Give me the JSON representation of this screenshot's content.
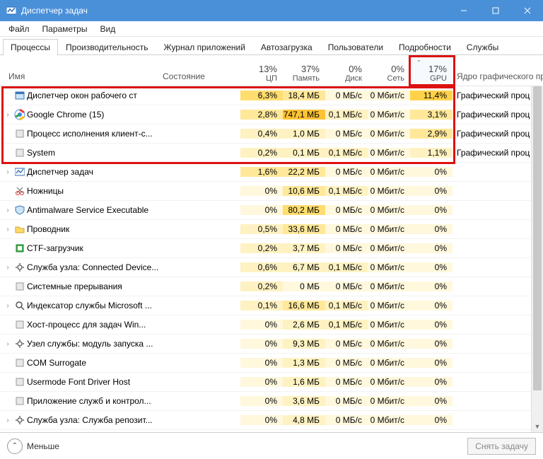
{
  "window": {
    "title": "Диспетчер задач"
  },
  "menu": {
    "file": "Файл",
    "options": "Параметры",
    "view": "Вид"
  },
  "tabs": {
    "processes": "Процессы",
    "performance": "Производительность",
    "apphistory": "Журнал приложений",
    "startup": "Автозагрузка",
    "users": "Пользователи",
    "details": "Подробности",
    "services": "Службы"
  },
  "columns": {
    "name": "Имя",
    "status": "Состояние",
    "cpu_pct": "13%",
    "cpu_lbl": "ЦП",
    "mem_pct": "37%",
    "mem_lbl": "Память",
    "disk_pct": "0%",
    "disk_lbl": "Диск",
    "net_pct": "0%",
    "net_lbl": "Сеть",
    "gpu_pct": "17%",
    "gpu_lbl": "GPU",
    "engine": "Ядро графического пр"
  },
  "rows": [
    {
      "exp": "",
      "icon": "window",
      "name": "Диспетчер окон рабочего ст",
      "cpu": "6,3%",
      "cpuH": 3,
      "mem": "18,4 МБ",
      "memH": 2,
      "disk": "0 МБ/с",
      "diskH": 0,
      "net": "0 Мбит/с",
      "netH": 0,
      "gpu": "11,4%",
      "gpuH": 4,
      "eng": "Графический проц"
    },
    {
      "exp": "›",
      "icon": "chrome",
      "name": "Google Chrome (15)",
      "cpu": "2,8%",
      "cpuH": 2,
      "mem": "747,1 МБ",
      "memH": 5,
      "disk": "0,1 МБ/с",
      "diskH": 1,
      "net": "0 Мбит/с",
      "netH": 0,
      "gpu": "3,1%",
      "gpuH": 2,
      "eng": "Графический проц"
    },
    {
      "exp": "",
      "icon": "app",
      "name": "Процесс исполнения клиент-с...",
      "cpu": "0,4%",
      "cpuH": 1,
      "mem": "1,0 МБ",
      "memH": 1,
      "disk": "0 МБ/с",
      "diskH": 0,
      "net": "0 Мбит/с",
      "netH": 0,
      "gpu": "2,9%",
      "gpuH": 2,
      "eng": "Графический проц"
    },
    {
      "exp": "",
      "icon": "app",
      "name": "System",
      "cpu": "0,2%",
      "cpuH": 1,
      "mem": "0,1 МБ",
      "memH": 1,
      "disk": "0,1 МБ/с",
      "diskH": 1,
      "net": "0 Мбит/с",
      "netH": 0,
      "gpu": "1,1%",
      "gpuH": 1,
      "eng": "Графический проц"
    },
    {
      "exp": "›",
      "icon": "taskmgr",
      "name": "Диспетчер задач",
      "cpu": "1,6%",
      "cpuH": 2,
      "mem": "22,2 МБ",
      "memH": 2,
      "disk": "0 МБ/с",
      "diskH": 0,
      "net": "0 Мбит/с",
      "netH": 0,
      "gpu": "0%",
      "gpuH": 0,
      "eng": ""
    },
    {
      "exp": "",
      "icon": "snip",
      "name": "Ножницы",
      "cpu": "0%",
      "cpuH": 0,
      "mem": "10,6 МБ",
      "memH": 2,
      "disk": "0,1 МБ/с",
      "diskH": 1,
      "net": "0 Мбит/с",
      "netH": 0,
      "gpu": "0%",
      "gpuH": 0,
      "eng": ""
    },
    {
      "exp": "›",
      "icon": "shield",
      "name": "Antimalware Service Executable",
      "cpu": "0%",
      "cpuH": 0,
      "mem": "80,2 МБ",
      "memH": 3,
      "disk": "0 МБ/с",
      "diskH": 0,
      "net": "0 Мбит/с",
      "netH": 0,
      "gpu": "0%",
      "gpuH": 0,
      "eng": ""
    },
    {
      "exp": "›",
      "icon": "folder",
      "name": "Проводник",
      "cpu": "0,5%",
      "cpuH": 1,
      "mem": "33,6 МБ",
      "memH": 2,
      "disk": "0 МБ/с",
      "diskH": 0,
      "net": "0 Мбит/с",
      "netH": 0,
      "gpu": "0%",
      "gpuH": 0,
      "eng": ""
    },
    {
      "exp": "",
      "icon": "ctf",
      "name": "CTF-загрузчик",
      "cpu": "0,2%",
      "cpuH": 1,
      "mem": "3,7 МБ",
      "memH": 1,
      "disk": "0 МБ/с",
      "diskH": 0,
      "net": "0 Мбит/с",
      "netH": 0,
      "gpu": "0%",
      "gpuH": 0,
      "eng": ""
    },
    {
      "exp": "›",
      "icon": "gear",
      "name": "Служба узла: Connected Device...",
      "cpu": "0,6%",
      "cpuH": 1,
      "mem": "6,7 МБ",
      "memH": 1,
      "disk": "0,1 МБ/с",
      "diskH": 1,
      "net": "0 Мбит/с",
      "netH": 0,
      "gpu": "0%",
      "gpuH": 0,
      "eng": ""
    },
    {
      "exp": "",
      "icon": "app",
      "name": "Системные прерывания",
      "cpu": "0,2%",
      "cpuH": 1,
      "mem": "0 МБ",
      "memH": 0,
      "disk": "0 МБ/с",
      "diskH": 0,
      "net": "0 Мбит/с",
      "netH": 0,
      "gpu": "0%",
      "gpuH": 0,
      "eng": ""
    },
    {
      "exp": "›",
      "icon": "search",
      "name": "Индексатор службы Microsoft ...",
      "cpu": "0,1%",
      "cpuH": 1,
      "mem": "16,6 МБ",
      "memH": 2,
      "disk": "0,1 МБ/с",
      "diskH": 1,
      "net": "0 Мбит/с",
      "netH": 0,
      "gpu": "0%",
      "gpuH": 0,
      "eng": ""
    },
    {
      "exp": "",
      "icon": "app",
      "name": "Хост-процесс для задач Win...",
      "cpu": "0%",
      "cpuH": 0,
      "mem": "2,6 МБ",
      "memH": 1,
      "disk": "0,1 МБ/с",
      "diskH": 1,
      "net": "0 Мбит/с",
      "netH": 0,
      "gpu": "0%",
      "gpuH": 0,
      "eng": ""
    },
    {
      "exp": "›",
      "icon": "gear",
      "name": "Узел службы: модуль запуска ...",
      "cpu": "0%",
      "cpuH": 0,
      "mem": "9,3 МБ",
      "memH": 1,
      "disk": "0 МБ/с",
      "diskH": 0,
      "net": "0 Мбит/с",
      "netH": 0,
      "gpu": "0%",
      "gpuH": 0,
      "eng": ""
    },
    {
      "exp": "",
      "icon": "app",
      "name": "COM Surrogate",
      "cpu": "0%",
      "cpuH": 0,
      "mem": "1,3 МБ",
      "memH": 1,
      "disk": "0 МБ/с",
      "diskH": 0,
      "net": "0 Мбит/с",
      "netH": 0,
      "gpu": "0%",
      "gpuH": 0,
      "eng": ""
    },
    {
      "exp": "",
      "icon": "app",
      "name": "Usermode Font Driver Host",
      "cpu": "0%",
      "cpuH": 0,
      "mem": "1,6 МБ",
      "memH": 1,
      "disk": "0 МБ/с",
      "diskH": 0,
      "net": "0 Мбит/с",
      "netH": 0,
      "gpu": "0%",
      "gpuH": 0,
      "eng": ""
    },
    {
      "exp": "",
      "icon": "app",
      "name": "Приложение служб и контрол...",
      "cpu": "0%",
      "cpuH": 0,
      "mem": "3,6 МБ",
      "memH": 1,
      "disk": "0 МБ/с",
      "diskH": 0,
      "net": "0 Мбит/с",
      "netH": 0,
      "gpu": "0%",
      "gpuH": 0,
      "eng": ""
    },
    {
      "exp": "›",
      "icon": "gear",
      "name": "Служба узла: Служба репозит...",
      "cpu": "0%",
      "cpuH": 0,
      "mem": "4,8 МБ",
      "memH": 1,
      "disk": "0 МБ/с",
      "diskH": 0,
      "net": "0 Мбит/с",
      "netH": 0,
      "gpu": "0%",
      "gpuH": 0,
      "eng": ""
    }
  ],
  "footer": {
    "less": "Меньше",
    "endtask": "Снять задачу"
  },
  "colors": {
    "accent": "#4a90d9",
    "highlight_border": "#d11"
  }
}
